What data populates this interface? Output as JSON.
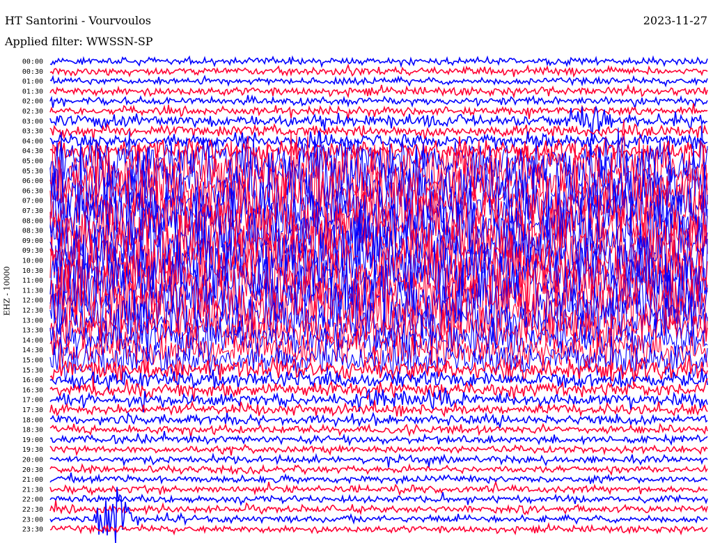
{
  "header": {
    "station": "HT Santorini - Vourvoulos",
    "date": "2023-11-27",
    "filter": "Applied filter: WWSSN-SP"
  },
  "channel_label": "EHZ - 10000",
  "colors": {
    "blue": "#0000ff",
    "red": "#ff0033"
  },
  "chart_data": {
    "type": "line",
    "title": "HT Santorini - Vourvoulos",
    "time_labels": [
      "00:00",
      "00:30",
      "01:00",
      "01:30",
      "02:00",
      "02:30",
      "03:00",
      "03:30",
      "04:00",
      "04:30",
      "05:00",
      "05:30",
      "06:00",
      "06:30",
      "07:00",
      "07:30",
      "08:00",
      "08:30",
      "09:00",
      "09:30",
      "10:00",
      "10:30",
      "11:00",
      "11:30",
      "12:00",
      "12:30",
      "13:00",
      "13:30",
      "14:00",
      "14:30",
      "15:00",
      "15:30",
      "16:00",
      "16:30",
      "17:00",
      "17:30",
      "18:00",
      "18:30",
      "19:00",
      "19:30",
      "20:00",
      "20:30",
      "21:00",
      "21:30",
      "22:00",
      "22:30",
      "23:00",
      "23:30"
    ],
    "trace_colors": [
      "blue",
      "red"
    ],
    "trace_amplitude": [
      0.5,
      0.55,
      0.5,
      0.6,
      0.55,
      0.6,
      0.9,
      0.8,
      1.0,
      1.5,
      3.5,
      4.5,
      5.0,
      5.0,
      5.0,
      5.0,
      5.0,
      5.0,
      5.0,
      5.0,
      5.0,
      5.0,
      5.0,
      5.0,
      5.0,
      5.0,
      4.0,
      3.0,
      2.8,
      2.8,
      2.5,
      1.5,
      1.2,
      1.0,
      0.9,
      0.8,
      0.7,
      0.6,
      0.55,
      0.5,
      0.5,
      0.5,
      0.5,
      0.5,
      0.5,
      0.5,
      0.5,
      0.5
    ],
    "events": [
      {
        "row": 6,
        "x_fraction": 0.82,
        "amplitude": 2.5
      },
      {
        "row": 34,
        "x_fraction": 0.49,
        "amplitude": 1.6
      },
      {
        "row": 34,
        "x_fraction": 0.6,
        "amplitude": 1.2
      },
      {
        "row": 21,
        "x_fraction": 0.59,
        "amplitude": 2.0
      },
      {
        "row": 46,
        "x_fraction": 0.1,
        "amplitude": 6.0
      }
    ]
  }
}
